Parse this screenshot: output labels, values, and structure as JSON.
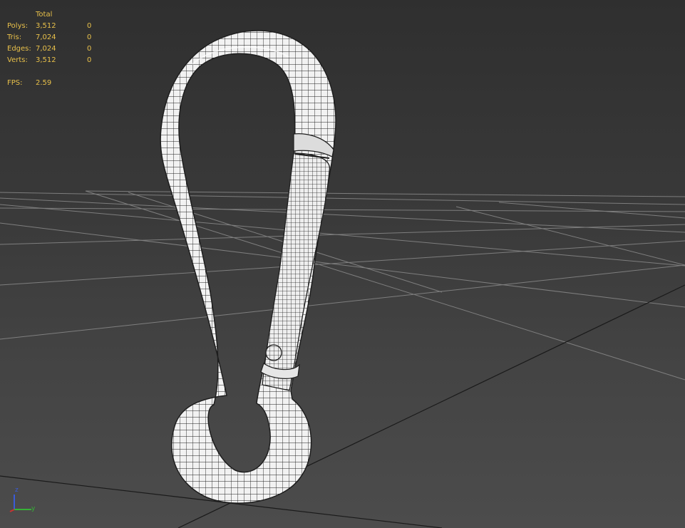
{
  "viewport": {
    "colors": {
      "background_top": "#2f2f2f",
      "background_bottom": "#4c4c4c",
      "grid_line": "#8a8a8a",
      "grid_main_line": "#1a1a1a",
      "stats_text": "#e8c04a",
      "mesh_fill": "#f2f2f2",
      "mesh_wire": "#1e1e1e"
    },
    "stats": {
      "header_total": "Total",
      "rows": [
        {
          "label": "Polys:",
          "total": "3,512",
          "selected": "0"
        },
        {
          "label": "Tris:",
          "total": "7,024",
          "selected": "0"
        },
        {
          "label": "Edges:",
          "total": "7,024",
          "selected": "0"
        },
        {
          "label": "Verts:",
          "total": "3,512",
          "selected": "0"
        }
      ],
      "fps_label": "FPS:",
      "fps_value": "2.59"
    },
    "axis_gizmo": {
      "z_label": "z",
      "y_label": "y",
      "z_color": "#3a5bd9",
      "y_color": "#36b336"
    },
    "model": {
      "icon": "carabiner-wireframe-mesh"
    }
  }
}
